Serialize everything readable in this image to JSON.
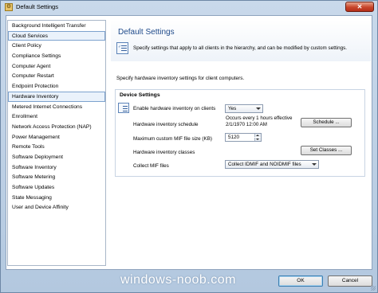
{
  "window": {
    "title": "Default Settings",
    "close_label": "✕"
  },
  "sidebar": {
    "items": [
      {
        "label": "Background Intelligent Transfer",
        "selected": false
      },
      {
        "label": "Cloud Services",
        "selected": true
      },
      {
        "label": "Client Policy",
        "selected": false
      },
      {
        "label": "Compliance Settings",
        "selected": false
      },
      {
        "label": "Computer Agent",
        "selected": false
      },
      {
        "label": "Computer Restart",
        "selected": false
      },
      {
        "label": "Endpoint Protection",
        "selected": false
      },
      {
        "label": "Hardware Inventory",
        "selected": true
      },
      {
        "label": "Metered Internet Connections",
        "selected": false
      },
      {
        "label": "Enrollment",
        "selected": false
      },
      {
        "label": "Network Access Protection (NAP)",
        "selected": false
      },
      {
        "label": "Power Management",
        "selected": false
      },
      {
        "label": "Remote Tools",
        "selected": false
      },
      {
        "label": "Software Deployment",
        "selected": false
      },
      {
        "label": "Software Inventory",
        "selected": false
      },
      {
        "label": "Software Metering",
        "selected": false
      },
      {
        "label": "Software Updates",
        "selected": false
      },
      {
        "label": "State Messaging",
        "selected": false
      },
      {
        "label": "User and Device Affinity",
        "selected": false
      }
    ]
  },
  "header": {
    "title": "Default Settings",
    "description": "Specify settings that apply to all clients in the hierarchy, and can be modified by custom settings.",
    "icon": "settings-list-icon"
  },
  "main": {
    "intro": "Specify hardware inventory settings for client computers.",
    "group_title": "Device Settings",
    "group_icon": "settings-list-icon",
    "enable_label": "Enable hardware inventory on clients",
    "enable_value": "Yes",
    "schedule_label": "Hardware inventory schedule",
    "schedule_text_1": "Occurs every 1 hours effective",
    "schedule_text_2": "2/1/1970 12:00 AM",
    "schedule_button": "Schedule ...",
    "mif_size_label": "Maximum custom MIF file size (KB)",
    "mif_size_value": "5120",
    "classes_label": "Hardware inventory classes",
    "classes_button": "Set Classes ...",
    "collect_label": "Collect MIF files",
    "collect_value": "Collect IDMIF and NOIDMIF files"
  },
  "footer": {
    "ok_label": "OK",
    "cancel_label": "Cancel",
    "watermark": "windows-noob.com"
  }
}
